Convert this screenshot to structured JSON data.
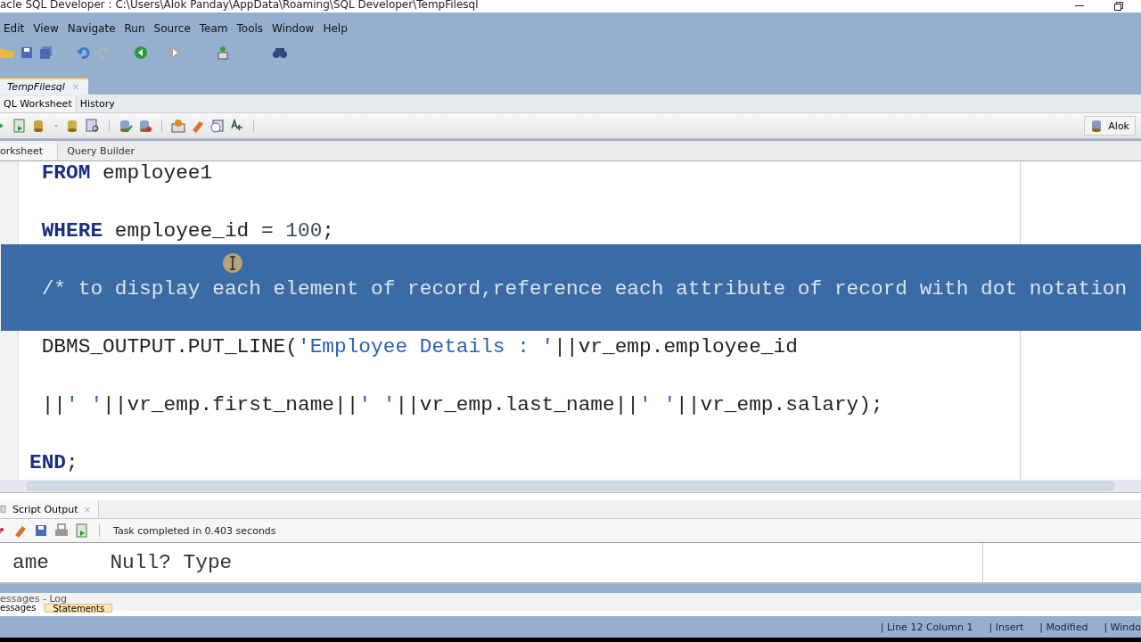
{
  "window": {
    "title": "acle SQL Developer : C:\\Users\\Alok Panday\\AppData\\Roaming\\SQL Developer\\TempFilesql"
  },
  "menu": [
    "Edit",
    "View",
    "Navigate",
    "Run",
    "Source",
    "Team",
    "Tools",
    "Window",
    "Help"
  ],
  "document_tabs": [
    {
      "label": "TempFilesql",
      "close": "×",
      "selected": true
    }
  ],
  "editor_tabs": [
    {
      "label": "QL Worksheet",
      "selected": true
    },
    {
      "label": "History",
      "selected": false
    }
  ],
  "connection": {
    "label": "Alok"
  },
  "worksheet_tabs": [
    {
      "label": "orksheet",
      "selected": true
    },
    {
      "label": "Query Builder",
      "selected": false
    }
  ],
  "code": [
    {
      "selected": false,
      "tokens": [
        {
          "kind": "keyword",
          "text": " FROM"
        },
        {
          "kind": "plain",
          "text": " employee1"
        }
      ]
    },
    {
      "selected": false,
      "tokens": [
        {
          "kind": "keyword",
          "text": " WHERE"
        },
        {
          "kind": "plain",
          "text": " employee_id = "
        },
        {
          "kind": "number",
          "text": "100"
        },
        {
          "kind": "plain",
          "text": ";"
        }
      ]
    },
    {
      "selected": true,
      "tokens": [
        {
          "kind": "comment",
          "text": " /* to display each element of record,reference each attribute of record with dot notation"
        }
      ]
    },
    {
      "selected": false,
      "tokens": [
        {
          "kind": "plain",
          "text": " DBMS_OUTPUT.PUT_LINE("
        },
        {
          "kind": "string",
          "text": "'Employee Details : '"
        },
        {
          "kind": "plain",
          "text": "||vr_emp.employee_id"
        }
      ]
    },
    {
      "selected": false,
      "tokens": [
        {
          "kind": "plain",
          "text": " ||"
        },
        {
          "kind": "string",
          "text": "' '"
        },
        {
          "kind": "plain",
          "text": "||vr_emp.first_name||"
        },
        {
          "kind": "string",
          "text": "' '"
        },
        {
          "kind": "plain",
          "text": "||vr_emp.last_name||"
        },
        {
          "kind": "string",
          "text": "' '"
        },
        {
          "kind": "plain",
          "text": "||vr_emp.salary);"
        }
      ]
    },
    {
      "selected": false,
      "tokens": [
        {
          "kind": "keyword",
          "text": "END"
        },
        {
          "kind": "plain",
          "text": ";"
        }
      ]
    }
  ],
  "output_panel": {
    "tab": "Script Output",
    "close": "×",
    "status": "Task completed in 0.403 seconds",
    "lines": [
      "ame     Null? Type"
    ]
  },
  "log_panel": {
    "title": "essages - Log",
    "tabs": [
      {
        "label": "essages",
        "selected": false
      },
      {
        "label": "Statements",
        "selected": true
      }
    ]
  },
  "status_bar": [
    "| Line 12 Column 1",
    "| Insert",
    "| Modified",
    "| Windo"
  ]
}
